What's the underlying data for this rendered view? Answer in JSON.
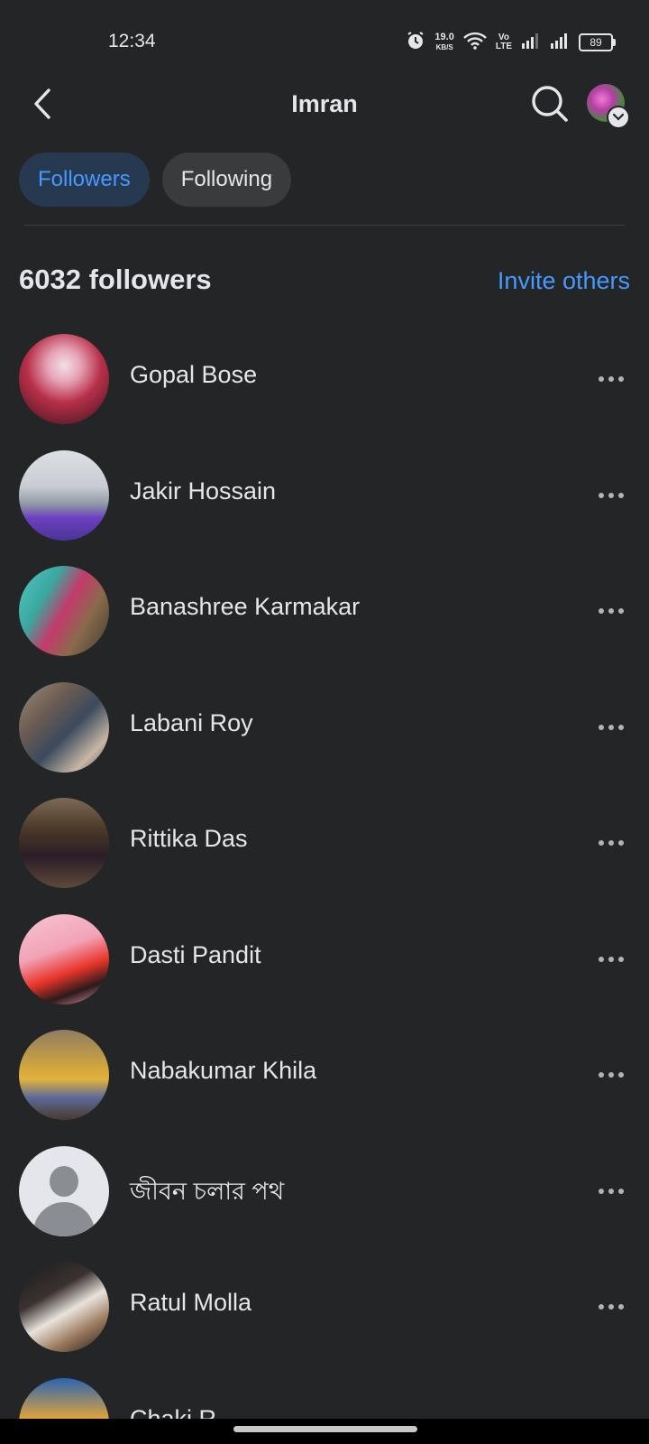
{
  "status_bar": {
    "time": "12:34",
    "speed_value": "19.0",
    "speed_unit": "KB/S",
    "volte_top": "Vo",
    "volte_bottom": "LTE",
    "battery": "89"
  },
  "header": {
    "title": "Imran"
  },
  "tabs": [
    {
      "label": "Followers",
      "active": true
    },
    {
      "label": "Following",
      "active": false
    }
  ],
  "summary": {
    "count_text": "6032 followers",
    "invite_label": "Invite others"
  },
  "followers": [
    {
      "name": "Gopal Bose"
    },
    {
      "name": "Jakir Hossain"
    },
    {
      "name": "Banashree Karmakar"
    },
    {
      "name": "Labani Roy"
    },
    {
      "name": "Rittika Das"
    },
    {
      "name": "Dasti Pandit"
    },
    {
      "name": "Nabakumar Khila"
    },
    {
      "name": "জীবন চলার পথ"
    },
    {
      "name": "Ratul Molla"
    },
    {
      "name": "Chaki R..."
    }
  ],
  "colors": {
    "background": "#242526",
    "accent": "#4599ff",
    "active_tab_bg": "#263951",
    "inactive_tab_bg": "#3a3b3c",
    "text": "#e4e6eb"
  }
}
